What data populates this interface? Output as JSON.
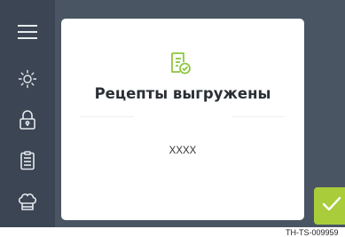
{
  "sidebar": {
    "items": [
      {
        "icon": "menu-icon"
      },
      {
        "icon": "sun-icon"
      },
      {
        "icon": "lock-icon"
      },
      {
        "icon": "recipe-list-icon"
      },
      {
        "icon": "chef-hat-icon"
      }
    ]
  },
  "dialog": {
    "icon": "recipe-check-icon",
    "title": "Рецепты выгружены",
    "body": "XXXX"
  },
  "confirm_button": {
    "icon": "checkmark-icon"
  },
  "footer": {
    "code": "TH-TS-009959"
  },
  "colors": {
    "background": "#4a5563",
    "sidebar": "#3b4553",
    "accent": "#a8cc3a",
    "icon_green": "#8cc63f",
    "dialog": "#ffffff"
  }
}
